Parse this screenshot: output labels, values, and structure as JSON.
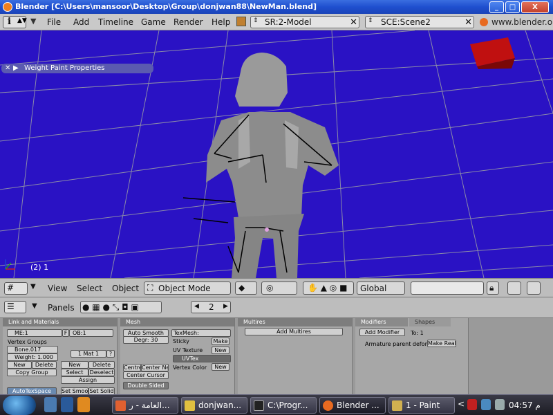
{
  "window": {
    "title": "Blender [C:\\Users\\mansoor\\Desktop\\Group\\donjwan88\\NewMan.blend]",
    "min": "_",
    "max": "□",
    "close": "X"
  },
  "menubar": {
    "items": [
      "File",
      "Add",
      "Timeline",
      "Game",
      "Render",
      "Help"
    ],
    "screen": "SR:2-Model",
    "scene": "SCE:Scene2",
    "url": "www.blender.or"
  },
  "viewport": {
    "panel_title": "Weight Paint Properties",
    "frame_label": "(2) 1"
  },
  "view3d_header": {
    "menus": [
      "View",
      "Select",
      "Object"
    ],
    "mode": "Object Mode",
    "orientation": "Global"
  },
  "buttons_header": {
    "panels_label": "Panels",
    "frame_value": "2",
    "prev": "◀",
    "next": "▶"
  },
  "link_materials": {
    "title": "Link and Materials",
    "mesh": "ME:1",
    "f": "F",
    "object": "OB:1",
    "vertex_groups_label": "Vertex Groups",
    "group_name": "Bone.017",
    "weight": "Weight: 1.000",
    "mat": "1 Mat 1",
    "q": "?",
    "btn_new": "New",
    "btn_delete": "Delete",
    "btn_copy_group": "Copy Group",
    "btn_select": "Select",
    "btn_deselect": "Deselect",
    "btn_assign": "Assign",
    "btn_set_smooth": "Set Smoo",
    "btn_set_solid": "Set Solid",
    "autotex": "AutoTexSpace"
  },
  "mesh": {
    "title": "Mesh",
    "auto_smooth": "Auto Smooth",
    "degr": "Degr: 30",
    "texmesh": "TexMesh:",
    "sticky": "Sticky",
    "make": "Make",
    "uv_texture": "UV Texture",
    "new": "New",
    "uvtex": "UVTex",
    "vertex_color": "Vertex Color",
    "centre": "Centre",
    "center_new": "Center Ne",
    "center_cursor": "Center Cursor",
    "double_sided": "Double Sided"
  },
  "multires": {
    "title": "Multires",
    "add": "Add Multires"
  },
  "modifiers": {
    "tab_modifiers": "Modifiers",
    "tab_shapes": "Shapes",
    "add_modifier": "Add Modifier",
    "to": "To: 1",
    "armature_text": "Armature parent deform",
    "make_real": "Make Real"
  },
  "taskbar": {
    "items": [
      "العامة - ر...",
      "donjwan...",
      "C:\\Progr...",
      "Blender ...",
      "1 - Paint"
    ],
    "time": "04:57 م",
    "arrow": "<"
  },
  "colors": {
    "viewport_bg": "#2a12c4",
    "grid": "#8a8aa8",
    "figure": "#8a8a8a"
  }
}
